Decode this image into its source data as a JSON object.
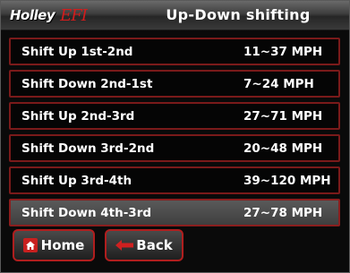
{
  "header": {
    "logo_brand": "Holley",
    "logo_efi": "EFI",
    "title": "Up-Down shifting"
  },
  "rows": [
    {
      "label": "Shift Up 1st-2nd",
      "value": "11~37 MPH"
    },
    {
      "label": "Shift Down 2nd-1st",
      "value": "7~24 MPH"
    },
    {
      "label": "Shift Up 2nd-3rd",
      "value": "27~71 MPH"
    },
    {
      "label": "Shift Down 3rd-2nd",
      "value": "20~48 MPH"
    },
    {
      "label": "Shift Up 3rd-4th",
      "value": "39~120 MPH"
    },
    {
      "label": "Shift Down 4th-3rd",
      "value": "27~78 MPH"
    }
  ],
  "selected_row": "Shift Down 4th-3rd",
  "buttons": {
    "home_label": "Home",
    "back_label": "Back"
  },
  "icons": {
    "home": "home-icon",
    "back": "back-arrow-icon"
  },
  "colors": {
    "accent": "#b01e1e",
    "row_border": "#7a1a1a",
    "background": "#0a0a0a",
    "selected_row": "#4a4a4a"
  }
}
